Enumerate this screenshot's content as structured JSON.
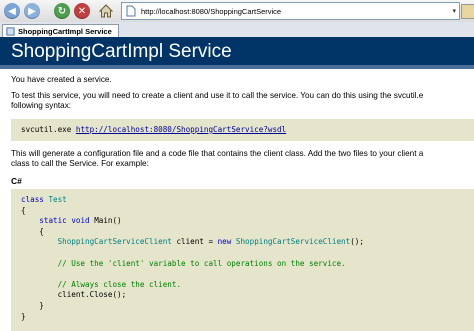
{
  "browser": {
    "url": "http://localhost:8080/ShoppingCartService",
    "tab_title": "ShoppingCartImpl Service"
  },
  "page": {
    "title": "ShoppingCartImpl Service",
    "intro": "You have created a service.",
    "test_line1": "To test this service, you will need to create a client and use it to call the service. You can do this using the svcutil.e",
    "test_line2": "following syntax:",
    "command_prefix": "svcutil.exe",
    "command_link": "http://localhost:8080/ShoppingCartService?wsdl",
    "generate_line1": "This will generate a configuration file and a code file that contains the client class. Add the two files to your client a",
    "generate_line2": "class to call the Service. For example:",
    "language_label": "C#"
  },
  "code": {
    "l1_kw": "class",
    "l1_name": "Test",
    "l2": "{",
    "l3_kw1": "static",
    "l3_kw2": "void",
    "l3_rest": "Main()",
    "l4": "{",
    "l5_type": "ShoppingCartServiceClient",
    "l5_mid": "client =",
    "l5_kw": "new",
    "l5_type2": "ShoppingCartServiceClient",
    "l5_end": "();",
    "l6_comment": "// Use the 'client' variable to call operations on the service.",
    "l7_comment": "// Always close the client.",
    "l8": "client.Close();",
    "l9": "}",
    "l10": "}"
  }
}
